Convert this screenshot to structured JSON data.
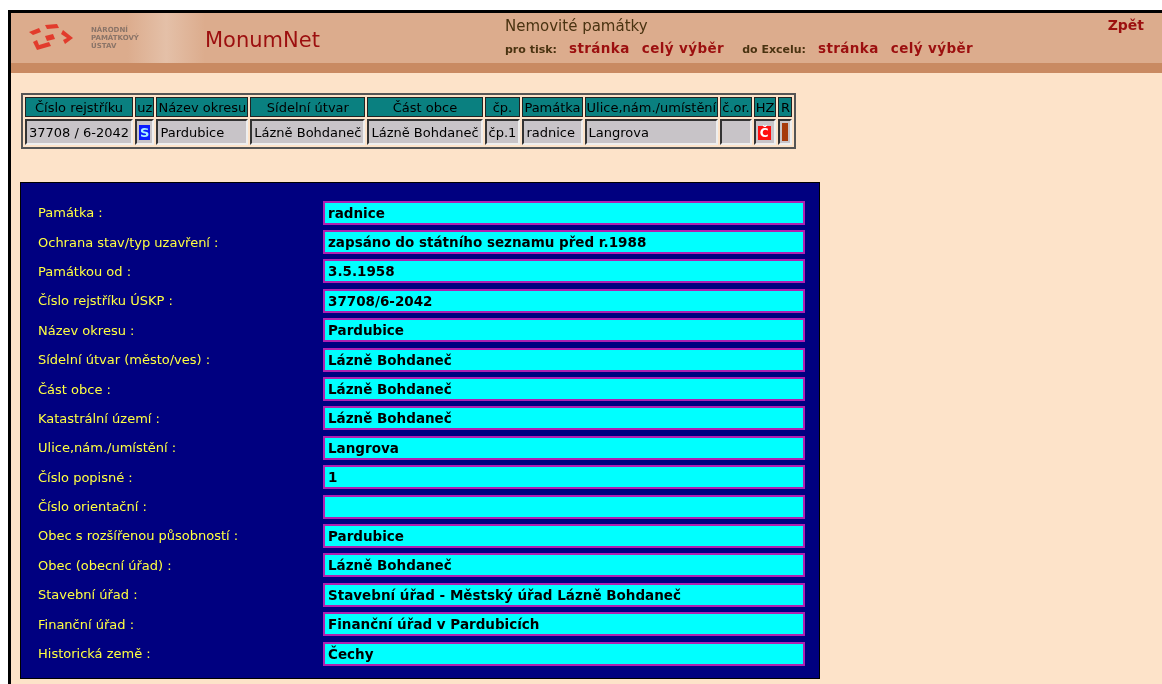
{
  "header": {
    "logo_text": [
      "NÁRODNÍ",
      "PAMÁTKOVÝ",
      "ÚSTAV"
    ],
    "app_name": "MonumNet",
    "title": "Nemovité památky",
    "back_link": "Zpět",
    "export_groups": [
      {
        "label": "pro tisk:",
        "links": [
          "stránka",
          "celý výběr"
        ]
      },
      {
        "label": "do Excelu:",
        "links": [
          "stránka",
          "celý výběr"
        ]
      }
    ]
  },
  "table": {
    "columns": [
      "Číslo rejstříku",
      "uz",
      "Název okresu",
      "Sídelní útvar",
      "Část obce",
      "čp.",
      "Památka",
      "Ulice,nám./umístění",
      "č.or.",
      "HZ",
      "R"
    ],
    "rows": [
      {
        "cells": [
          {
            "kind": "text",
            "text": "37708 / 6-2042"
          },
          {
            "kind": "badge",
            "text": "S"
          },
          {
            "kind": "text",
            "text": "Pardubice"
          },
          {
            "kind": "text",
            "text": "Lázně Bohdaneč"
          },
          {
            "kind": "text",
            "text": "Lázně Bohdaneč"
          },
          {
            "kind": "text",
            "text": "čp.1"
          },
          {
            "kind": "text",
            "text": "radnice"
          },
          {
            "kind": "text",
            "text": "Langrova"
          },
          {
            "kind": "empty"
          },
          {
            "kind": "flag",
            "text": "Č"
          },
          {
            "kind": "bar"
          }
        ]
      }
    ]
  },
  "details": [
    {
      "label": "Památka :",
      "value": "radnice"
    },
    {
      "label": "Ochrana stav/typ uzavření :",
      "value": "zapsáno do státního seznamu před r.1988"
    },
    {
      "label": "Památkou od :",
      "value": "3.5.1958"
    },
    {
      "label": "Číslo rejstříku ÚSKP :",
      "value": "37708/6-2042"
    },
    {
      "label": "Název okresu :",
      "value": "Pardubice"
    },
    {
      "label": "Sídelní útvar (město/ves) :",
      "value": "Lázně Bohdaneč"
    },
    {
      "label": "Část obce :",
      "value": "Lázně Bohdaneč"
    },
    {
      "label": "Katastrální území :",
      "value": "Lázně Bohdaneč"
    },
    {
      "label": "Ulice,nám./umístění :",
      "value": "Langrova"
    },
    {
      "label": "Číslo popisné :",
      "value": "1"
    },
    {
      "label": "Číslo orientační :"
    },
    {
      "label": "Obec s rozšířenou působností :",
      "value": "Pardubice"
    },
    {
      "label": "Obec (obecní úřad) :",
      "value": "Lázně Bohdaneč"
    },
    {
      "label": "Stavební úřad :",
      "value": "Stavební úřad - Městský úřad Lázně Bohdaneč"
    },
    {
      "label": "Finanční úřad :",
      "value": "Finanční úřad v Pardubicích"
    },
    {
      "label": "Historická země :",
      "value": "Čechy"
    }
  ]
}
